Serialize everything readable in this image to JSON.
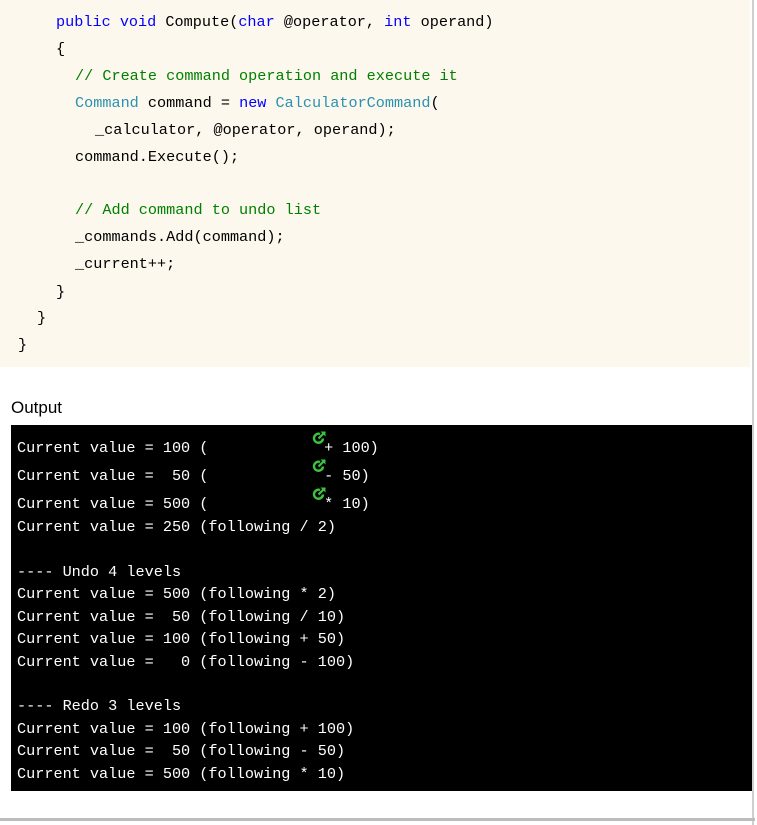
{
  "code": {
    "signature": {
      "kw1": "public",
      "kw2": "void",
      "name": " Compute(",
      "type1": "char",
      "param1": " @operator, ",
      "type2": "int",
      "param2": " operand)"
    },
    "open_brace": "{",
    "comment1": "// Create command operation and execute it",
    "decl": {
      "type": "Command",
      "middle": " command = ",
      "kw_new": "new",
      "space": " ",
      "ctor": "CalculatorCommand",
      "tail": "("
    },
    "args": "_calculator, @operator, operand);",
    "execute": "command.Execute();",
    "comment2": "// Add command to undo list",
    "add": "_commands.Add(command);",
    "increment": "_current++;",
    "close_method": "}",
    "close_class": "}",
    "close_outer": "}"
  },
  "output_label": "Output",
  "console": {
    "first_lines": [
      {
        "lead": "Current value = 100 (",
        "tail": " + 100)"
      },
      {
        "lead": "Current value =  50 (",
        "tail": " - 50)"
      },
      {
        "lead": "Current value = 500 (",
        "tail": " * 10)"
      }
    ],
    "line4": "Current value = 250 (following / 2)",
    "undo_header": "---- Undo 4 levels",
    "undo_lines": [
      "Current value = 500 (following * 2)",
      "Current value =  50 (following / 10)",
      "Current value = 100 (following + 50)",
      "Current value =   0 (following - 100)"
    ],
    "redo_header": "---- Redo 3 levels",
    "redo_lines": [
      "Current value = 100 (following + 100)",
      "Current value =  50 (following - 50)",
      "Current value = 500 (following * 10)"
    ],
    "icon_color": "#3cc43c"
  }
}
